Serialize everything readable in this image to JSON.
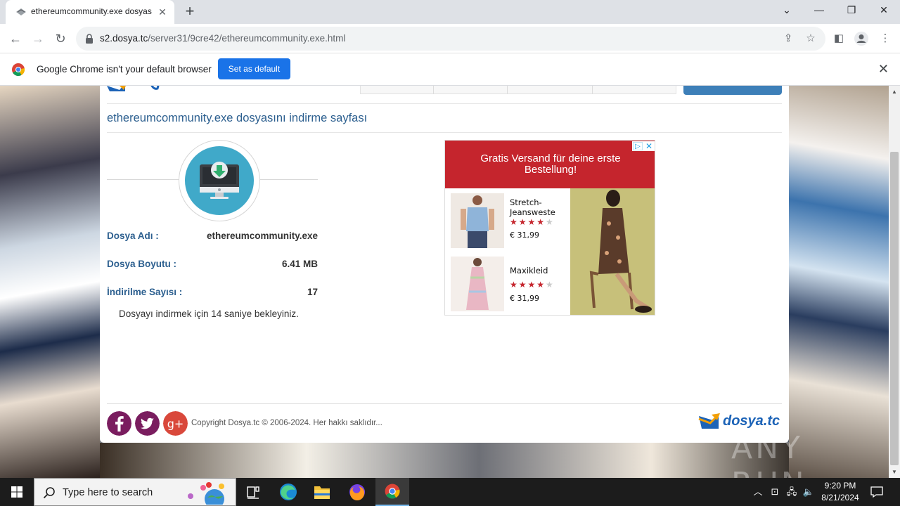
{
  "browser": {
    "tab_title": "ethereumcommunity.exe dosyas",
    "url_host": "s2.dosya.tc",
    "url_path": "/server31/9cre42/ethereumcommunity.exe.html"
  },
  "infobar": {
    "message": "Google Chrome isn't your default browser",
    "button_label": "Set as default"
  },
  "page": {
    "title": "ethereumcommunity.exe dosyasını indirme sayfası",
    "file_name_label": "Dosya Adı :",
    "file_name_value": "ethereumcommunity.exe",
    "file_size_label": "Dosya Boyutu :",
    "file_size_value": "6.41 MB",
    "download_count_label": "İndirilme Sayısı :",
    "download_count_value": "17",
    "wait_message": "Dosyayı indirmek için 14 saniye bekleyiniz."
  },
  "ad": {
    "headline": "Gratis Versand für deine erste Bestellung!",
    "products": [
      {
        "name": "Stretch-Jeansweste",
        "rating": 4,
        "price": "€ 31,99"
      },
      {
        "name": "Maxikleid",
        "rating": 4,
        "price": "€ 31,99"
      }
    ],
    "brand_color": "#c5252d"
  },
  "footer": {
    "copyright": "Copyright Dosya.tc © 2006-2024. Her hakkı saklıdır...",
    "logo_text": "dosya.tc"
  },
  "watermark": "ANY RUN",
  "taskbar": {
    "search_placeholder": "Type here to search",
    "time": "9:20 PM",
    "date": "8/21/2024"
  },
  "icons": [
    "shield-favicon-icon",
    "lock-icon",
    "share-icon",
    "star-icon",
    "sidepanel-icon",
    "profile-icon",
    "kebab-menu-icon",
    "chrome-icon",
    "facebook-icon",
    "twitter-icon",
    "google-plus-icon",
    "windows-icon",
    "search-icon",
    "task-view-icon",
    "edge-icon",
    "file-explorer-icon",
    "firefox-icon",
    "chrome-icon"
  ],
  "colors": {
    "title_blue": "#2c5f8f",
    "download_teal": "#40a9c9",
    "chrome_button": "#1a73e8",
    "facebook": "#7a1d5f",
    "twitter": "#7a1d5f",
    "google_plus": "#d9483b"
  }
}
